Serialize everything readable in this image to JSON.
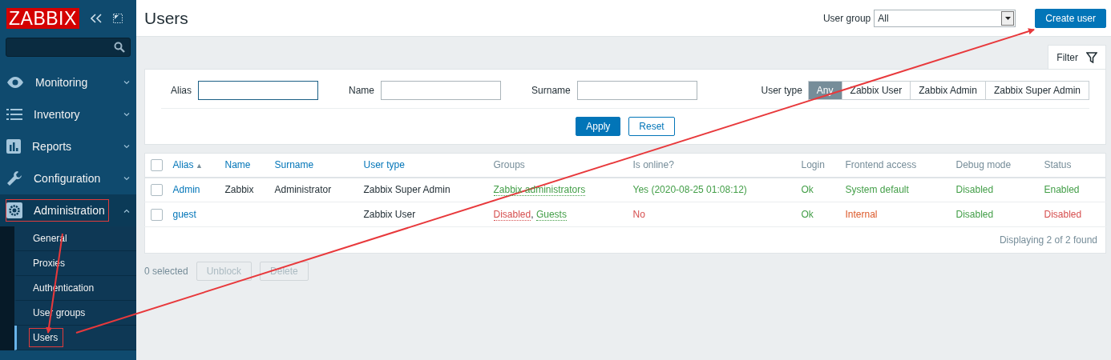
{
  "sidebar": {
    "logo": "ZABBIX",
    "menu": [
      {
        "label": "Monitoring",
        "expanded": false,
        "annotated": false
      },
      {
        "label": "Inventory",
        "expanded": false,
        "annotated": false
      },
      {
        "label": "Reports",
        "expanded": false,
        "annotated": false
      },
      {
        "label": "Configuration",
        "expanded": false,
        "annotated": false
      },
      {
        "label": "Administration",
        "expanded": true,
        "annotated": true,
        "children": [
          {
            "label": "General",
            "selected": false,
            "annotated": false
          },
          {
            "label": "Proxies",
            "selected": false,
            "annotated": false
          },
          {
            "label": "Authentication",
            "selected": false,
            "annotated": false
          },
          {
            "label": "User groups",
            "selected": false,
            "annotated": false
          },
          {
            "label": "Users",
            "selected": true,
            "annotated": true
          }
        ]
      }
    ]
  },
  "header": {
    "title": "Users",
    "user_group_label": "User group",
    "user_group_value": "All",
    "create_button": "Create user"
  },
  "filter": {
    "tab": "Filter",
    "fields": [
      {
        "label": "Alias",
        "focused": true
      },
      {
        "label": "Name",
        "focused": false
      },
      {
        "label": "Surname",
        "focused": false
      }
    ],
    "user_type_label": "User type",
    "user_types": [
      {
        "label": "Any",
        "selected": true
      },
      {
        "label": "Zabbix User",
        "selected": false
      },
      {
        "label": "Zabbix Admin",
        "selected": false
      },
      {
        "label": "Zabbix Super Admin",
        "selected": false
      }
    ],
    "apply": "Apply",
    "reset": "Reset"
  },
  "table": {
    "all_checked": false,
    "columns": [
      {
        "label": "Alias",
        "sortable": true,
        "sorted": true,
        "sort_arrow": "▲"
      },
      {
        "label": "Name",
        "sortable": true,
        "sorted": false
      },
      {
        "label": "Surname",
        "sortable": true,
        "sorted": false
      },
      {
        "label": "User type",
        "sortable": true,
        "sorted": false
      },
      {
        "label": "Groups",
        "sortable": false
      },
      {
        "label": "Is online?",
        "sortable": false
      },
      {
        "label": "Login",
        "sortable": false
      },
      {
        "label": "Frontend access",
        "sortable": false
      },
      {
        "label": "Debug mode",
        "sortable": false
      },
      {
        "label": "Status",
        "sortable": false
      }
    ],
    "rows": [
      {
        "checked": false,
        "cells": [
          {
            "kind": "link",
            "text": "Admin"
          },
          {
            "kind": "text",
            "text": "Zabbix"
          },
          {
            "kind": "text",
            "text": "Administrator"
          },
          {
            "kind": "text",
            "text": "Zabbix Super Admin"
          },
          {
            "kind": "groups",
            "parts": [
              {
                "text": "Zabbix administrators",
                "color": "#429e47"
              }
            ]
          },
          {
            "kind": "status",
            "text": "Yes (2020-08-25 01:08:12)",
            "color": "#429e47"
          },
          {
            "kind": "status",
            "text": "Ok",
            "color": "#429e47"
          },
          {
            "kind": "status",
            "text": "System default",
            "color": "#429e47"
          },
          {
            "kind": "status",
            "text": "Disabled",
            "color": "#429e47"
          },
          {
            "kind": "status",
            "text": "Enabled",
            "color": "#429e47"
          }
        ]
      },
      {
        "checked": false,
        "cells": [
          {
            "kind": "link",
            "text": "guest"
          },
          {
            "kind": "empty"
          },
          {
            "kind": "empty"
          },
          {
            "kind": "text",
            "text": "Zabbix User"
          },
          {
            "kind": "groups",
            "separator": ",",
            "parts": [
              {
                "text": "Disabled",
                "color": "#d64e4e"
              },
              {
                "text": "Guests",
                "color": "#429e47"
              }
            ]
          },
          {
            "kind": "status",
            "text": "No",
            "color": "#d64e4e"
          },
          {
            "kind": "status",
            "text": "Ok",
            "color": "#429e47"
          },
          {
            "kind": "status",
            "text": "Internal",
            "color": "#dc5a2b"
          },
          {
            "kind": "status",
            "text": "Disabled",
            "color": "#429e47"
          },
          {
            "kind": "status",
            "text": "Disabled",
            "color": "#d64e4e"
          }
        ]
      }
    ],
    "summary": "Displaying 2 of 2 found"
  },
  "footer": {
    "selected": "0 selected",
    "buttons": [
      {
        "label": "Unblock",
        "disabled": true
      },
      {
        "label": "Delete",
        "disabled": true
      }
    ]
  },
  "annotations": [
    {
      "kind": "arrow"
    },
    {
      "kind": "arrow"
    }
  ]
}
